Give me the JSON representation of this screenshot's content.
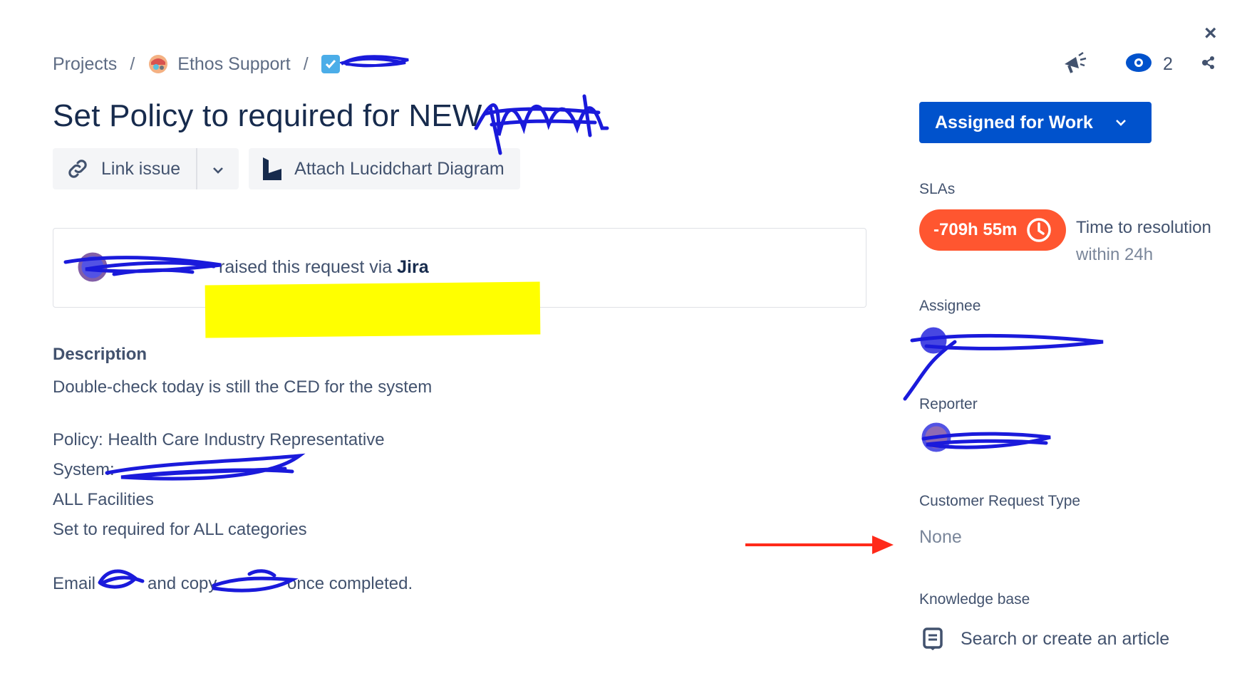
{
  "breadcrumb": {
    "projects": "Projects",
    "separator": "/",
    "project_name": "Ethos Support"
  },
  "issue": {
    "title": "Set Policy to required for NEW"
  },
  "actions": {
    "link_issue": "Link issue",
    "attach_lucidchart": "Attach Lucidchart Diagram"
  },
  "request": {
    "raised_text": "raised this request via ",
    "channel": "Jira"
  },
  "description": {
    "label": "Description",
    "lines": [
      "Double-check today is still the CED for the system",
      "Policy:  Health Care Industry Representative",
      "System:",
      "ALL Facilities",
      "Set to required for ALL categories",
      "Email",
      "and copy",
      "once completed."
    ]
  },
  "header_icons": {
    "watchers_count": "2",
    "close": "×"
  },
  "status": {
    "label": "Assigned for Work"
  },
  "sidebar": {
    "slas_label": "SLAs",
    "sla_value": "-709h 55m",
    "sla_name": "Time to resolution",
    "sla_target": "within 24h",
    "assignee_label": "Assignee",
    "reporter_label": "Reporter",
    "request_type_label": "Customer Request Type",
    "request_type_value": "None",
    "kb_label": "Knowledge base",
    "kb_action": "Search or create an article"
  },
  "colors": {
    "status_blue": "#0052cc",
    "sla_red": "#ff5630",
    "highlight_yellow": "#ffff00",
    "scribble_blue": "#1a1adb",
    "arrow_red": "#ff2a1a"
  }
}
